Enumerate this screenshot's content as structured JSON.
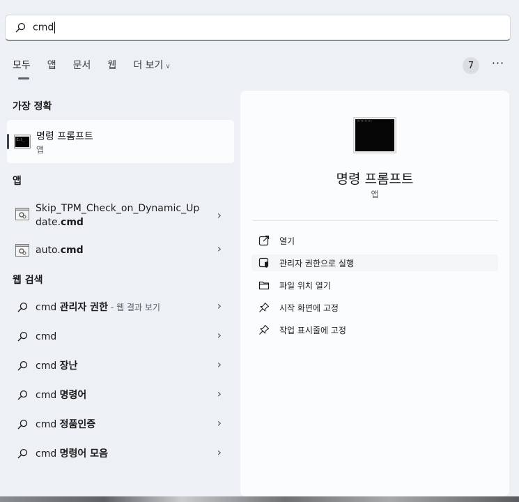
{
  "search": {
    "value": "cmd"
  },
  "tabs": [
    {
      "label": "모두"
    },
    {
      "label": "앱"
    },
    {
      "label": "문서"
    },
    {
      "label": "웹"
    },
    {
      "label": "더 보기"
    }
  ],
  "count_badge": "7",
  "more_glyph": "···",
  "sections": {
    "best_match": "가장 정확",
    "apps": "앱",
    "web_search": "웹 검색"
  },
  "best_match": {
    "title": "명령 프롬프트",
    "subtitle": "앱",
    "icon": "command-prompt-icon"
  },
  "apps": [
    {
      "line1": "Skip_TPM_Check_on_Dynamic_Up",
      "line2_prefix": "date.",
      "line2_bold": "cmd",
      "icon": "script-file-icon"
    },
    {
      "prefix": "auto.",
      "bold": "cmd",
      "icon": "script-file-icon"
    }
  ],
  "web_results": [
    {
      "prefix": "cmd ",
      "bold": "관리자 권한",
      "suffix": "- 웹 결과 보기"
    },
    {
      "prefix": "cmd",
      "bold": "",
      "suffix": ""
    },
    {
      "prefix": "cmd ",
      "bold": "장난",
      "suffix": ""
    },
    {
      "prefix": "cmd ",
      "bold": "명령어",
      "suffix": ""
    },
    {
      "prefix": "cmd ",
      "bold": "정품인증",
      "suffix": ""
    },
    {
      "prefix": "cmd ",
      "bold": "명령어 모음",
      "suffix": ""
    }
  ],
  "detail": {
    "title": "명령 프롬프트",
    "subtitle": "앱",
    "actions": [
      {
        "label": "열기",
        "icon": "open-external-icon"
      },
      {
        "label": "관리자 권한으로 실행",
        "icon": "admin-shield-icon"
      },
      {
        "label": "파일 위치 열기",
        "icon": "folder-icon"
      },
      {
        "label": "시작 화면에 고정",
        "icon": "pin-icon"
      },
      {
        "label": "작업 표시줄에 고정",
        "icon": "pin-icon"
      }
    ]
  },
  "colors": {
    "panel_bg": "#edf1f5",
    "card_bg": "#fbfcfd",
    "accent": "#3d4650"
  }
}
